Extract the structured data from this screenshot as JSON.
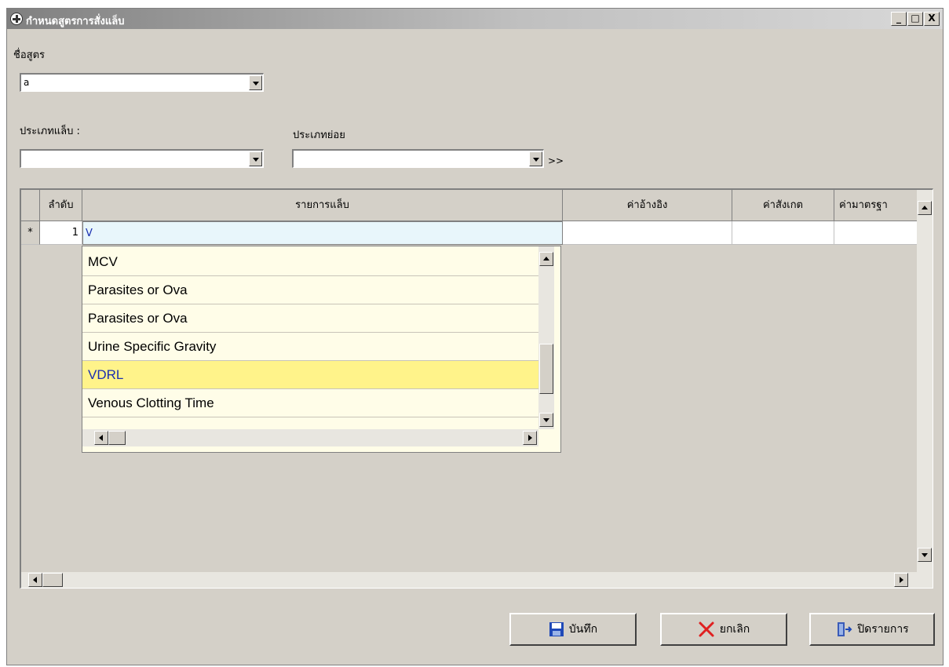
{
  "window": {
    "title": "กำหนดสูตรการสั่งแล็บ",
    "controls": [
      "_",
      "□",
      "X"
    ]
  },
  "form": {
    "formula_label": "ชื่อสูตร",
    "formula_value": "a",
    "lab_type_label": "ประเภทแล็บ :",
    "lab_type_value": "",
    "subtype_label": "ประเภทย่อย",
    "subtype_value": "",
    "more_label": ">>"
  },
  "grid": {
    "columns": [
      "ลำดับ",
      "รายการแล็บ",
      "ค่าอ้างอิง",
      "ค่าสังเกต",
      "ค่ามาตรฐา"
    ],
    "rows": [
      {
        "marker": "*",
        "seq": "1",
        "item": "V",
        "ref": "",
        "obs": "",
        "std": ""
      }
    ]
  },
  "autocomplete": {
    "items": [
      "MCV",
      "Parasites or Ova",
      "Parasites or Ova",
      "Urine  Specific Gravity",
      "VDRL",
      "Venous Clotting Time"
    ],
    "selected": "VDRL"
  },
  "buttons": {
    "save": "บันทึก",
    "cancel": "ยกเลิก",
    "close": "ปิดรายการ"
  },
  "colors": {
    "selected_row": "#fff38a",
    "selected_text": "#1a2fb0",
    "cancel_icon": "#e02020",
    "save_icon": "#1f49b8"
  }
}
